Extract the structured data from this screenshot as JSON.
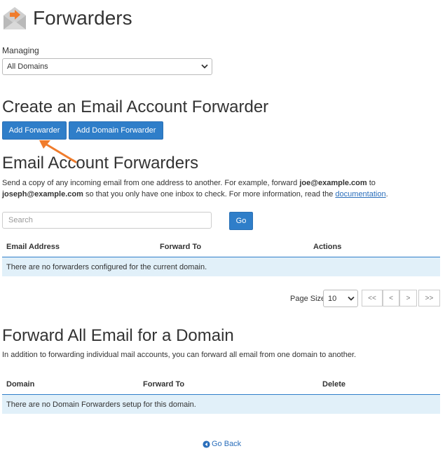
{
  "header": {
    "title": "Forwarders"
  },
  "managing": {
    "label": "Managing",
    "selected": "All Domains"
  },
  "create_section": {
    "title": "Create an Email Account Forwarder",
    "add_forwarder": "Add Forwarder",
    "add_domain_forwarder": "Add Domain Forwarder"
  },
  "account_forwarders": {
    "title": "Email Account Forwarders",
    "desc_part1": "Send a copy of any incoming email from one address to another. For example, forward ",
    "example_from": "joe@example.com",
    "desc_part2": " to",
    "example_to": "joseph@example.com",
    "desc_part3": " so that you only have one inbox to check. For more information, read the ",
    "doc_link": "documentation",
    "desc_end": ".",
    "search_placeholder": "Search",
    "go_label": "Go",
    "columns": [
      "Email Address",
      "Forward To",
      "Actions"
    ],
    "empty_message": "There are no forwarders configured for the current domain."
  },
  "pagination": {
    "page_size_label": "Page Size",
    "page_size": "10",
    "first": "<<",
    "prev": "<",
    "next": ">",
    "last": ">>"
  },
  "domain_forwarders": {
    "title": "Forward All Email for a Domain",
    "desc": "In addition to forwarding individual mail accounts, you can forward all email from one domain to another.",
    "columns": [
      "Domain",
      "Forward To",
      "Delete"
    ],
    "empty_message": "There are no Domain Forwarders setup for this domain."
  },
  "footer": {
    "go_back": "Go Back"
  },
  "colors": {
    "primary": "#2f7ec9",
    "row_bg": "#e1f0f9",
    "annotation": "#f07c2c",
    "logo_orange": "#f07c2c"
  },
  "icons": {
    "logo": "envelope-forward-icon",
    "back": "arrow-circle-left-icon",
    "dropdown": "chevron-down-icon"
  }
}
